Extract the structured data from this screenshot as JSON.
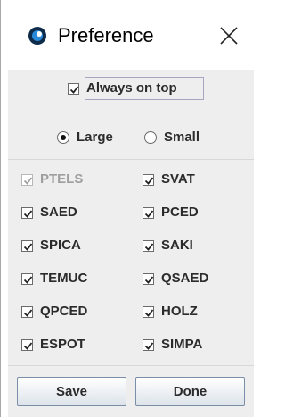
{
  "window": {
    "title": "Preference",
    "close_symbol": "✕",
    "icon": "app-icon"
  },
  "options": {
    "always_on_top": {
      "label": "Always on top",
      "checked": true
    }
  },
  "size": {
    "selected": "Large",
    "options": [
      "Large",
      "Small"
    ]
  },
  "sources": [
    {
      "label": "PTELS",
      "checked": true,
      "enabled": false
    },
    {
      "label": "SVAT",
      "checked": true,
      "enabled": true
    },
    {
      "label": "SAED",
      "checked": true,
      "enabled": true
    },
    {
      "label": "PCED",
      "checked": true,
      "enabled": true
    },
    {
      "label": "SPICA",
      "checked": true,
      "enabled": true
    },
    {
      "label": "SAKI",
      "checked": true,
      "enabled": true
    },
    {
      "label": "TEMUC",
      "checked": true,
      "enabled": true
    },
    {
      "label": "QSAED",
      "checked": true,
      "enabled": true
    },
    {
      "label": "QPCED",
      "checked": true,
      "enabled": true
    },
    {
      "label": "HOLZ",
      "checked": true,
      "enabled": true
    },
    {
      "label": "ESPOT",
      "checked": true,
      "enabled": true
    },
    {
      "label": "SIMPA",
      "checked": true,
      "enabled": true
    }
  ],
  "buttons": {
    "save": "Save",
    "done": "Done"
  }
}
